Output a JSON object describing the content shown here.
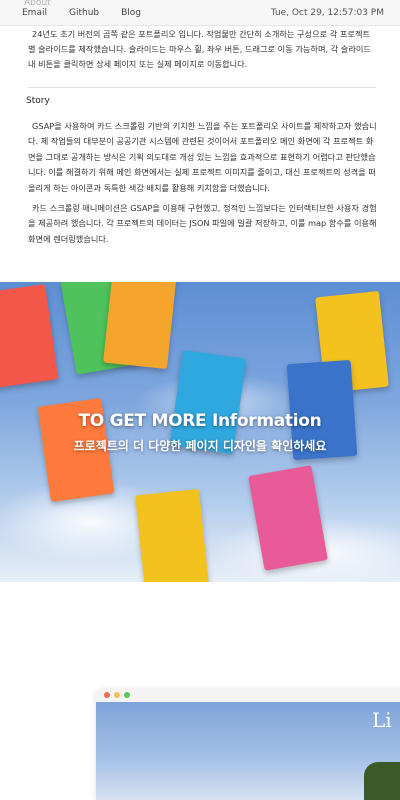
{
  "topbar": {
    "ghost_label": "About",
    "nav": [
      "Email",
      "Github",
      "Blog"
    ],
    "clock": "Tue, Oct 29, 12:57:03 PM"
  },
  "intro": "24년도 초기 버전의 곰쪽 같은 포트폴리오 입니다. 작업물만 간단히 소개하는 구성으로 각 프로젝트 별 슬라이드를 제작했습니다. 슬라이드는 마우스 휠, 좌우 버튼, 드래그로 이동 가능하며, 각 슬라이드 내 비튼을 클릭하면 상세 페이지 또는 실제 페이지로 이동합니다.",
  "story": {
    "heading": "Story",
    "p1": "GSAP을 사용하여 카드 스크롤링 기반의 키치한 느낌을 주는 포트폴리오 사이트를 제작하고자 했습니다. 제 작업들의 대부분이 공공기관 시스템에 관련된 것이어서 포트폴리오 메인 화면에 각 프로젝트 화면을 그대로 공개하는 방식은 기획 의도대로 개성 있는 느낌을 효과적으로 표현하기 어렵다고 판단했습니다. 이를 해결하기 위해 메인 화면에서는 실제 프로젝트 이미지를 줄이고, 대신 프로젝트의 성격을 떠올리게 하는 아이콘과 독특한 색감 배치를 활용해 키치함을 더했습니다.",
    "p2": "카드 스크롤링 애니메이션은 GSAP을 이용해 구현했고, 정적인 느낌보다는 인터랙티브한 사용자 경험을 제공하려 했습니다. 각 프로젝트의 데이터는 JSON 파일에 일괄 저장하고, 이를 map 함수를 이용해 화면에 렌더링했습니다."
  },
  "banner": {
    "title": "TO GET MORE Information",
    "subtitle": "프로젝트의 더 다양한 페이지 디자인을 확인하세요",
    "card_colors": [
      "#f2574a",
      "#4fc35b",
      "#2fa7df",
      "#f3c21f",
      "#e85a98",
      "#f4a52b",
      "#3a73c9",
      "#f3c21f",
      "#ff7a3c"
    ]
  },
  "preview": {
    "dot_colors": [
      "#ef6b5e",
      "#f4bf4f",
      "#5fc454"
    ],
    "screen_title": "Li"
  }
}
